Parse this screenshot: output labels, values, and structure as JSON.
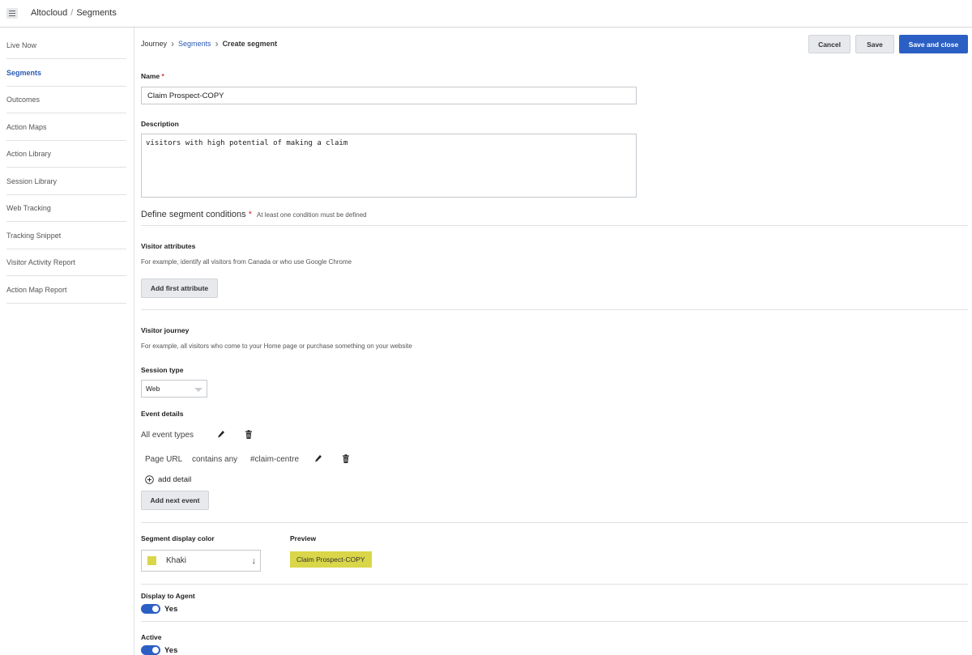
{
  "app": {
    "menu_icon": "hamburger-icon",
    "crumb_root": "Altocloud",
    "crumb_sep": "/",
    "crumb_page": "Segments"
  },
  "sidebar": {
    "items": [
      {
        "label": "Live Now",
        "active": false
      },
      {
        "label": "Segments",
        "active": true
      },
      {
        "label": "Outcomes",
        "active": false
      },
      {
        "label": "Action Maps",
        "active": false
      },
      {
        "label": "Action Library",
        "active": false
      },
      {
        "label": "Session Library",
        "active": false
      },
      {
        "label": "Web Tracking",
        "active": false
      },
      {
        "label": "Tracking Snippet",
        "active": false
      },
      {
        "label": "Visitor Activity Report",
        "active": false
      },
      {
        "label": "Action Map Report",
        "active": false
      }
    ]
  },
  "breadcrumb": {
    "journey": "Journey",
    "segments": "Segments",
    "current": "Create segment"
  },
  "actions": {
    "cancel": "Cancel",
    "save": "Save",
    "save_close": "Save and close"
  },
  "form": {
    "name_label": "Name",
    "required_mark": "*",
    "name_value": "Claim Prospect-COPY",
    "description_label": "Description",
    "description_value": "visitors with high potential of making a claim",
    "conditions_title": "Define segment conditions",
    "conditions_note": "At least one condition must be defined"
  },
  "visitor_attributes": {
    "title": "Visitor attributes",
    "help": "For example, identify all visitors from Canada or who use Google Chrome",
    "add_button": "Add first attribute"
  },
  "visitor_journey": {
    "title": "Visitor journey",
    "help": "For example, all visitors who come to your Home page or purchase something on your website",
    "session_type_label": "Session type",
    "session_type_value": "Web",
    "event_details_label": "Event details",
    "event_types": "All event types",
    "detail": {
      "field": "Page URL",
      "operator": "contains any",
      "value": "#claim-centre"
    },
    "add_detail": "add detail",
    "add_next_event": "Add next event"
  },
  "display": {
    "color_label": "Segment display color",
    "color_value": "Khaki",
    "color_hex": "#d9d649",
    "preview_label": "Preview",
    "preview_text": "Claim Prospect-COPY"
  },
  "toggles": {
    "agent_label": "Display to Agent",
    "agent_value": "Yes",
    "active_label": "Active",
    "active_value": "Yes"
  },
  "colors": {
    "accent": "#2b5fc4",
    "link": "#2a5bb3"
  }
}
